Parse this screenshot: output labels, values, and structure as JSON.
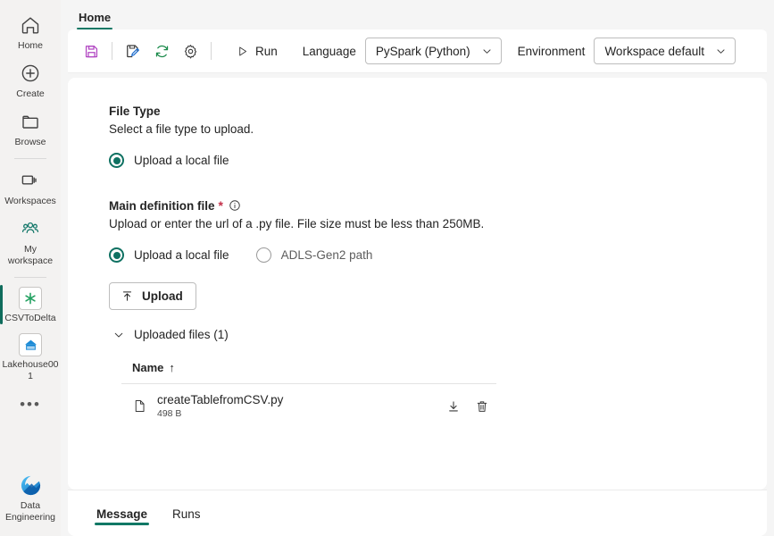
{
  "sidebar": {
    "items": [
      {
        "label": "Home",
        "icon": "home-icon"
      },
      {
        "label": "Create",
        "icon": "plus-circle-icon"
      },
      {
        "label": "Browse",
        "icon": "folder-icon"
      },
      {
        "label": "Workspaces",
        "icon": "workspaces-icon"
      },
      {
        "label": "My workspace",
        "icon": "people-icon"
      },
      {
        "label": "CSVToDelta",
        "icon": "spark-job-definition-icon"
      },
      {
        "label": "Lakehouse001",
        "icon": "lakehouse-icon"
      }
    ],
    "more_label": "•••",
    "footer": {
      "label": "Data Engineering",
      "icon": "data-engineering-icon"
    },
    "accent_color": "#0f6c5c"
  },
  "ribbon": {
    "tabs": [
      {
        "label": "Home",
        "active": true
      }
    ],
    "active_underline_color": "#117865"
  },
  "toolbar": {
    "save_label": "Save",
    "edit_label": "Edit",
    "refresh_label": "Refresh",
    "settings_label": "Settings",
    "run_label": "Run",
    "language_label": "Language",
    "language_value": "PySpark (Python)",
    "environment_label": "Environment",
    "environment_value": "Workspace default",
    "save_icon_color": "#b146c2",
    "refresh_icon_color": "#1a8a4a",
    "pencil_icon_color": "#1f6fd0"
  },
  "main": {
    "file_type": {
      "title": "File Type",
      "description": "Select a file type to upload.",
      "options": [
        {
          "label": "Upload a local file",
          "selected": true
        }
      ]
    },
    "main_definition_file": {
      "title": "Main definition file",
      "required_marker": "*",
      "info_icon": "info-icon",
      "description": "Upload or enter the url of a .py file. File size must be less than 250MB.",
      "options": [
        {
          "label": "Upload a local file",
          "selected": true
        },
        {
          "label": "ADLS-Gen2 path",
          "selected": false
        }
      ],
      "upload_button_label": "Upload",
      "uploaded_files_label": "Uploaded files (1)",
      "uploaded_files_expanded": true,
      "table": {
        "columns": [
          {
            "label": "Name",
            "sort_indicator": "↑"
          }
        ],
        "rows": [
          {
            "name": "createTablefromCSV.py",
            "size": "498 B",
            "file_icon": "document-icon",
            "actions": [
              "download-icon",
              "delete-icon"
            ]
          }
        ]
      }
    }
  },
  "bottom_tabs": [
    {
      "label": "Message",
      "active": true
    },
    {
      "label": "Runs",
      "active": false
    }
  ]
}
